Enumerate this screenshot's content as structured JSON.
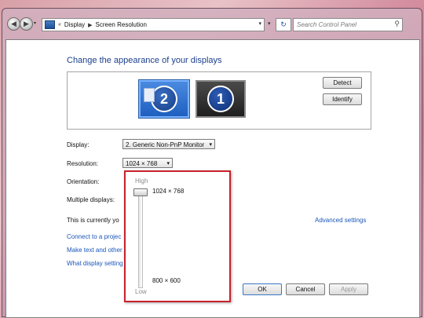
{
  "titlebar": {
    "breadcrumb": [
      "Display",
      "Screen Resolution"
    ],
    "search_placeholder": "Search Control Panel",
    "back_glyph": "◀",
    "forward_glyph": "▶",
    "crumb_prefix": "«",
    "crumb_sep": "▶",
    "dropdown_glyph": "▾",
    "refresh_glyph": "↻",
    "search_glyph": "⚲"
  },
  "main": {
    "title": "Change the appearance of your displays",
    "monitors": [
      {
        "number": "2",
        "selected": true
      },
      {
        "number": "1",
        "selected": false
      }
    ],
    "detect_label": "Detect",
    "identify_label": "Identify",
    "display_label": "Display:",
    "display_value": "2. Generic Non-PnP Monitor",
    "resolution_label": "Resolution:",
    "resolution_value": "1024 × 768",
    "orientation_label": "Orientation:",
    "multiple_label": "Multiple displays:",
    "current_text": "This is currently yo",
    "advanced_link": "Advanced settings",
    "links": [
      "Connect to a projec",
      "Make text and other",
      "What display setting"
    ],
    "ok_label": "OK",
    "cancel_label": "Cancel",
    "apply_label": "Apply"
  },
  "resolution_popup": {
    "high_label": "High",
    "low_label": "Low",
    "top_value": "1024 × 768",
    "bottom_value": "800 × 600",
    "slider_level": 1.0
  },
  "colors": {
    "highlight_border": "#c8232c",
    "link": "#1a56b8",
    "title": "#1b3f8c"
  }
}
